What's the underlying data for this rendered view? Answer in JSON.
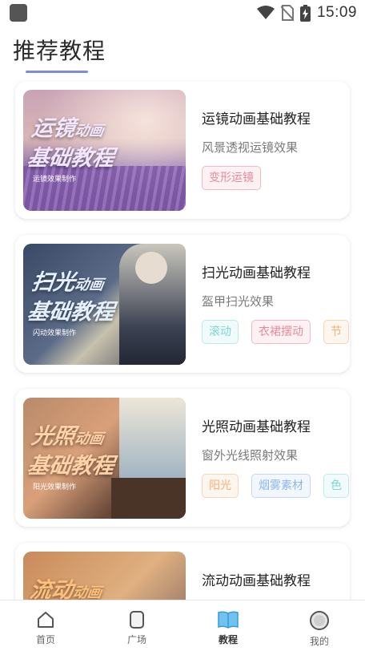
{
  "status": {
    "time": "15:09"
  },
  "page": {
    "title": "推荐教程"
  },
  "courses": [
    {
      "name": "运镜动画基础教程",
      "desc": "风景透视运镜效果",
      "thumb_line1": "运镜",
      "thumb_line1_suffix": "动画",
      "thumb_line2": "基础教程",
      "thumb_sub": "运镜效果制作",
      "tags": [
        {
          "label": "变形运镜",
          "style": "pink"
        }
      ]
    },
    {
      "name": "扫光动画基础教程",
      "desc": "盔甲扫光效果",
      "thumb_line1": "扫光",
      "thumb_line1_suffix": "动画",
      "thumb_line2": "基础教程",
      "thumb_sub": "闪动效果制作",
      "tags": [
        {
          "label": "滚动",
          "style": "cyan"
        },
        {
          "label": "衣裙摆动",
          "style": "pink"
        },
        {
          "label": "节",
          "style": "orange"
        }
      ]
    },
    {
      "name": "光照动画基础教程",
      "desc": "窗外光线照射效果",
      "thumb_line1": "光照",
      "thumb_line1_suffix": "动画",
      "thumb_line2": "基础教程",
      "thumb_sub": "阳光效果制作",
      "tags": [
        {
          "label": "阳光",
          "style": "orange"
        },
        {
          "label": "烟雾素材",
          "style": "blue"
        },
        {
          "label": "色",
          "style": "cyan"
        }
      ]
    },
    {
      "name": "流动动画基础教程",
      "desc": "",
      "thumb_line1": "流动",
      "thumb_line1_suffix": "动画",
      "thumb_line2": "",
      "thumb_sub": "",
      "tags": []
    }
  ],
  "tabbar": {
    "items": [
      {
        "label": "首页",
        "icon": "home-icon"
      },
      {
        "label": "广场",
        "icon": "square-icon"
      },
      {
        "label": "教程",
        "icon": "book-icon",
        "active": true
      },
      {
        "label": "我的",
        "icon": "profile-icon"
      }
    ]
  }
}
